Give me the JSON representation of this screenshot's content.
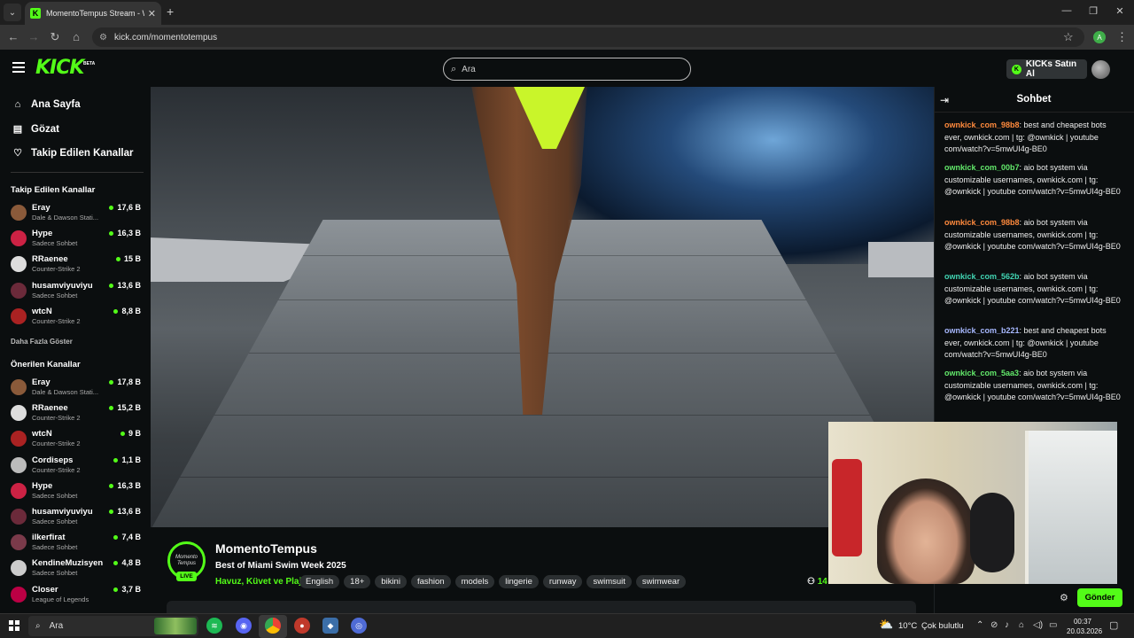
{
  "browser": {
    "tab_title": "MomentoTempus Stream - Wat",
    "url": "kick.com/momentotempus",
    "profile_initial": "A"
  },
  "header": {
    "logo": "KICK",
    "logo_badge": "BETA",
    "search_placeholder": "Ara",
    "buy_kicks_label": "KICKs Satın Al"
  },
  "sidebar": {
    "nav": [
      {
        "label": "Ana Sayfa",
        "icon": "home-icon"
      },
      {
        "label": "Gözat",
        "icon": "browse-icon"
      },
      {
        "label": "Takip Edilen Kanallar",
        "icon": "heart-icon"
      }
    ],
    "followed_heading": "Takip Edilen Kanallar",
    "followed": [
      {
        "name": "Eray",
        "sub": "Dale & Dawson Stati...",
        "viewers": "17,6 B"
      },
      {
        "name": "Hype",
        "sub": "Sadece Sohbet",
        "viewers": "16,3 B"
      },
      {
        "name": "RRaenee",
        "sub": "Counter-Strike 2",
        "viewers": "15 B"
      },
      {
        "name": "husamviyuviyu",
        "sub": "Sadece Sohbet",
        "viewers": "13,6 B"
      },
      {
        "name": "wtcN",
        "sub": "Counter-Strike 2",
        "viewers": "8,8 B"
      }
    ],
    "show_more": "Daha Fazla Göster",
    "recommended_heading": "Önerilen Kanallar",
    "recommended": [
      {
        "name": "Eray",
        "sub": "Dale & Dawson Stati...",
        "viewers": "17,8 B"
      },
      {
        "name": "RRaenee",
        "sub": "Counter-Strike 2",
        "viewers": "15,2 B"
      },
      {
        "name": "wtcN",
        "sub": "Counter-Strike 2",
        "viewers": "9 B"
      },
      {
        "name": "Cordiseps",
        "sub": "Counter-Strike 2",
        "viewers": "1,1 B"
      },
      {
        "name": "Hype",
        "sub": "Sadece Sohbet",
        "viewers": "16,3 B"
      },
      {
        "name": "husamviyuviyu",
        "sub": "Sadece Sohbet",
        "viewers": "13,6 B"
      },
      {
        "name": "ilkerfirat",
        "sub": "Sadece Sohbet",
        "viewers": "7,4 B"
      },
      {
        "name": "KendineMuzisyen",
        "sub": "Sadece Sohbet",
        "viewers": "4,8 B"
      },
      {
        "name": "Closer",
        "sub": "League of Legends",
        "viewers": "3,7 B"
      }
    ]
  },
  "stream": {
    "channel": "MomentoTempus",
    "avatar_text": "Momento Tempus",
    "live_badge": "LIVE",
    "title": "Best of Miami Swim Week 2025",
    "category": "Havuz, Küvet ve Plaj",
    "tags": [
      "English",
      "18+",
      "bikini",
      "fashion",
      "models",
      "lingerie",
      "runway",
      "swimsuit",
      "swimwear"
    ],
    "viewers": "14"
  },
  "chat": {
    "title": "Sohbet",
    "send_label": "Gönder",
    "messages": [
      {
        "user": "ownkick_com_98b8",
        "color": "#ff8a3d",
        "text": ": best and cheapest bots ever, ownkick.com | tg: @ownkick | youtube com/watch?v=5mwUI4g-BE0"
      },
      {
        "user": "ownkick_com_00b7",
        "color": "#63e96b",
        "text": ": aio bot system via customizable usernames, ownkick.com | tg: @ownkick | youtube com/watch?v=5mwUI4g-BE0"
      },
      {
        "user": "ownkick_com_98b8",
        "color": "#ff8a3d",
        "text": ": aio bot system via customizable usernames, ownkick.com | tg: @ownkick | youtube com/watch?v=5mwUI4g-BE0"
      },
      {
        "user": "ownkick_com_562b",
        "color": "#42d6b4",
        "text": ": aio bot system via customizable usernames, ownkick.com | tg: @ownkick | youtube com/watch?v=5mwUI4g-BE0"
      },
      {
        "user": "ownkick_com_b221",
        "color": "#a7b8ff",
        "text": ": best and cheapest bots ever, ownkick.com | tg: @ownkick | youtube com/watch?v=5mwUI4g-BE0"
      },
      {
        "user": "ownkick_com_5aa3",
        "color": "#63e96b",
        "text": ": aio bot system via customizable usernames, ownkick.com | tg: @ownkick | youtube com/watch?v=5mwUI4g-BE0"
      }
    ]
  },
  "taskbar": {
    "search_placeholder": "Ara",
    "temperature": "10°C",
    "weather": "Çok bulutlu",
    "time": "00:37",
    "date": "20.03.2026"
  },
  "colors": {
    "kick_green": "#53fc18",
    "background": "#0b0e0f"
  }
}
